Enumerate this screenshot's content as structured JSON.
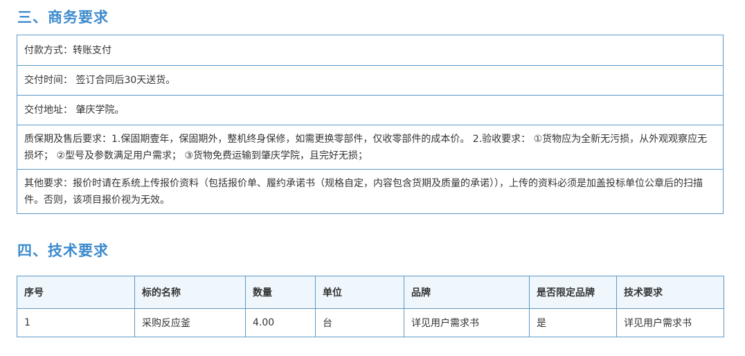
{
  "commerce": {
    "title": "三、商务要求",
    "rows": [
      "付款方式：转账支付",
      "交付时间：  签订合同后30天送货。",
      "交付地址：  肇庆学院。",
      "质保期及售后要求：1.保固期壹年，保固期外，整机终身保修，如需更换零部件，仅收零部件的成本价。 2.验收要求：  ①货物应为全新无污损，从外观观察应无损坏；  ②型号及参数满足用户需求；  ③货物免费运输到肇庆学院，且完好无损；",
      "其他要求：报价时请在系统上传报价资料（包括报价单、履约承诺书（规格自定，内容包含货期及质量的承诺）），上传的资料必须是加盖投标单位公章后的扫描件。否则，该项目报价视为无效。"
    ]
  },
  "tech": {
    "title": "四、技术要求",
    "headers": [
      "序号",
      "标的名称",
      "数量",
      "单位",
      "品牌",
      "是否限定品牌",
      "技术要求"
    ],
    "rows": [
      [
        "1",
        "采购反应釜",
        "4.00",
        "台",
        "详见用户需求书",
        "是",
        "详见用户需求书"
      ]
    ]
  },
  "colors": {
    "heading": "#3d8bcd",
    "border": "#5b97c6",
    "header_bg": "#eff7fd"
  }
}
